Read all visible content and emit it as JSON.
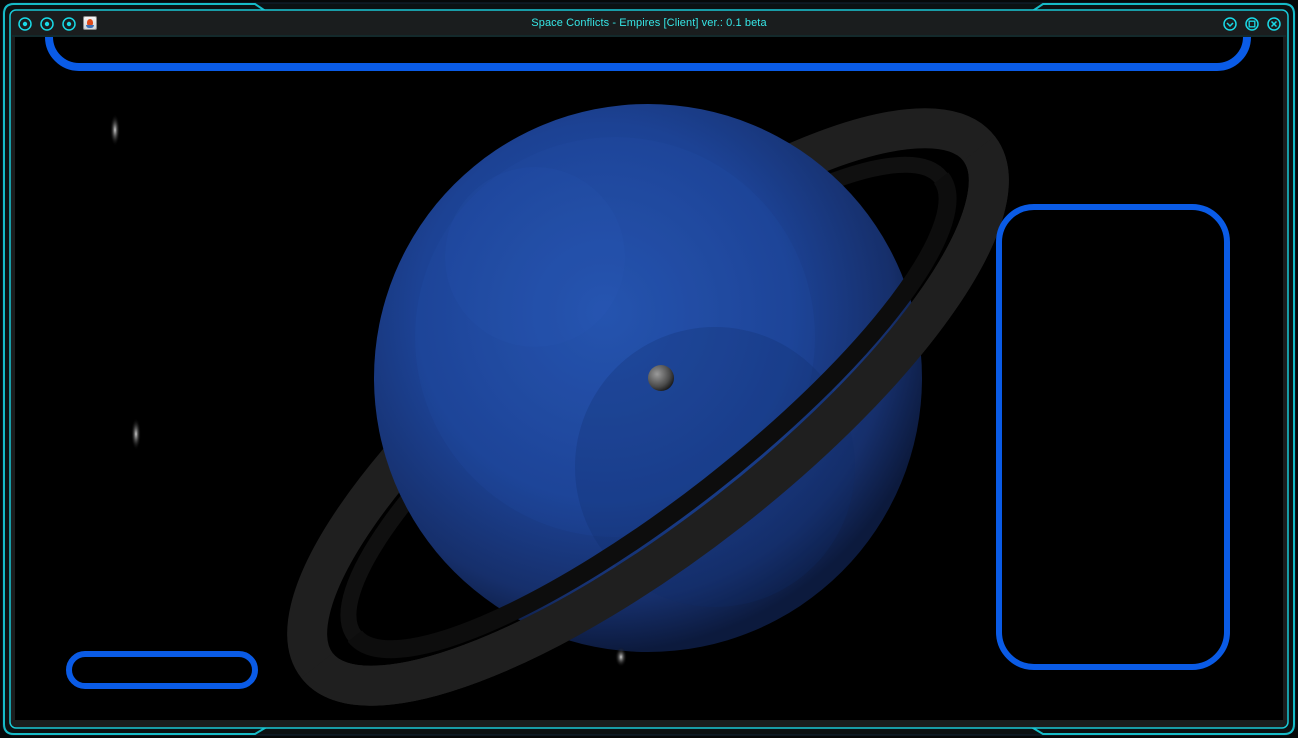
{
  "window": {
    "title": "Space Conflicts - Empires [Client] ver.: 0.1 beta"
  },
  "titlebar_left_buttons": [
    {
      "name": "circle-target-icon"
    },
    {
      "name": "circle-target-icon"
    },
    {
      "name": "circle-target-icon"
    }
  ],
  "app_icon": "java-cup-icon",
  "titlebar_right_buttons": [
    {
      "name": "minimize-chevron-icon"
    },
    {
      "name": "maximize-square-icon"
    },
    {
      "name": "close-x-icon"
    }
  ],
  "colors": {
    "frame_accent": "#19d9e6",
    "hud_blue": "#0a5be6",
    "title_text": "#36e6e6",
    "planet": "#1a3f8a",
    "ring": "#1f1f1f",
    "background": "#000000"
  }
}
